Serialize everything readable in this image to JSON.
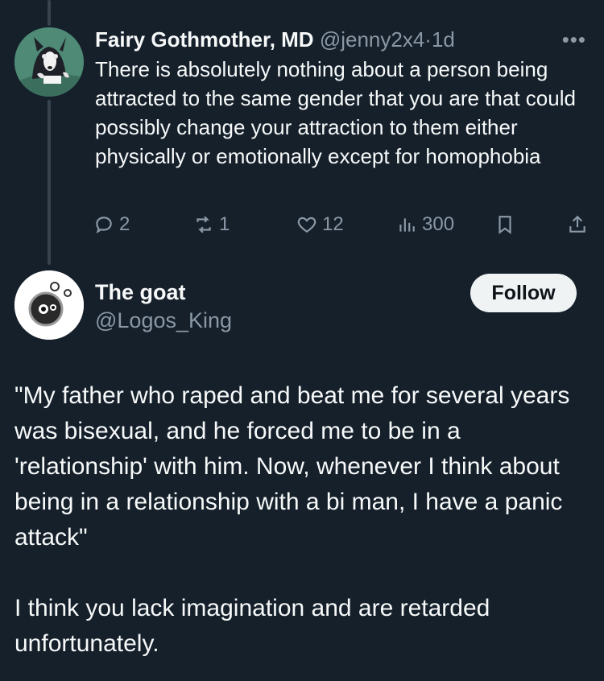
{
  "tweet1": {
    "display_name": "Fairy Gothmother, MD",
    "handle": "@jenny2x4",
    "separator": "·",
    "time": "1d",
    "text": "There is absolutely nothing about a person being attracted to the same gender that you are that could possibly change your attraction to them either physically or emotionally except for homophobia",
    "replies": "2",
    "retweets": "1",
    "likes": "12",
    "views": "300",
    "more_icon": "more-horizontal-icon"
  },
  "tweet2": {
    "display_name": "The goat",
    "handle": "@Logos_King",
    "follow_label": "Follow",
    "text": "\"My father who raped and beat me for several years was bisexual, and he forced me to be in a 'relationship' with him. Now, whenever I think about being in a relationship with a bi man, I have a panic attack\"\n\nI think you lack imagination and are retarded unfortunately."
  },
  "colors": {
    "background": "#15202b",
    "text": "#f7f9f9",
    "muted": "#8b98a5",
    "thread_line": "#38444d",
    "follow_button_bg": "#eff3f4"
  }
}
